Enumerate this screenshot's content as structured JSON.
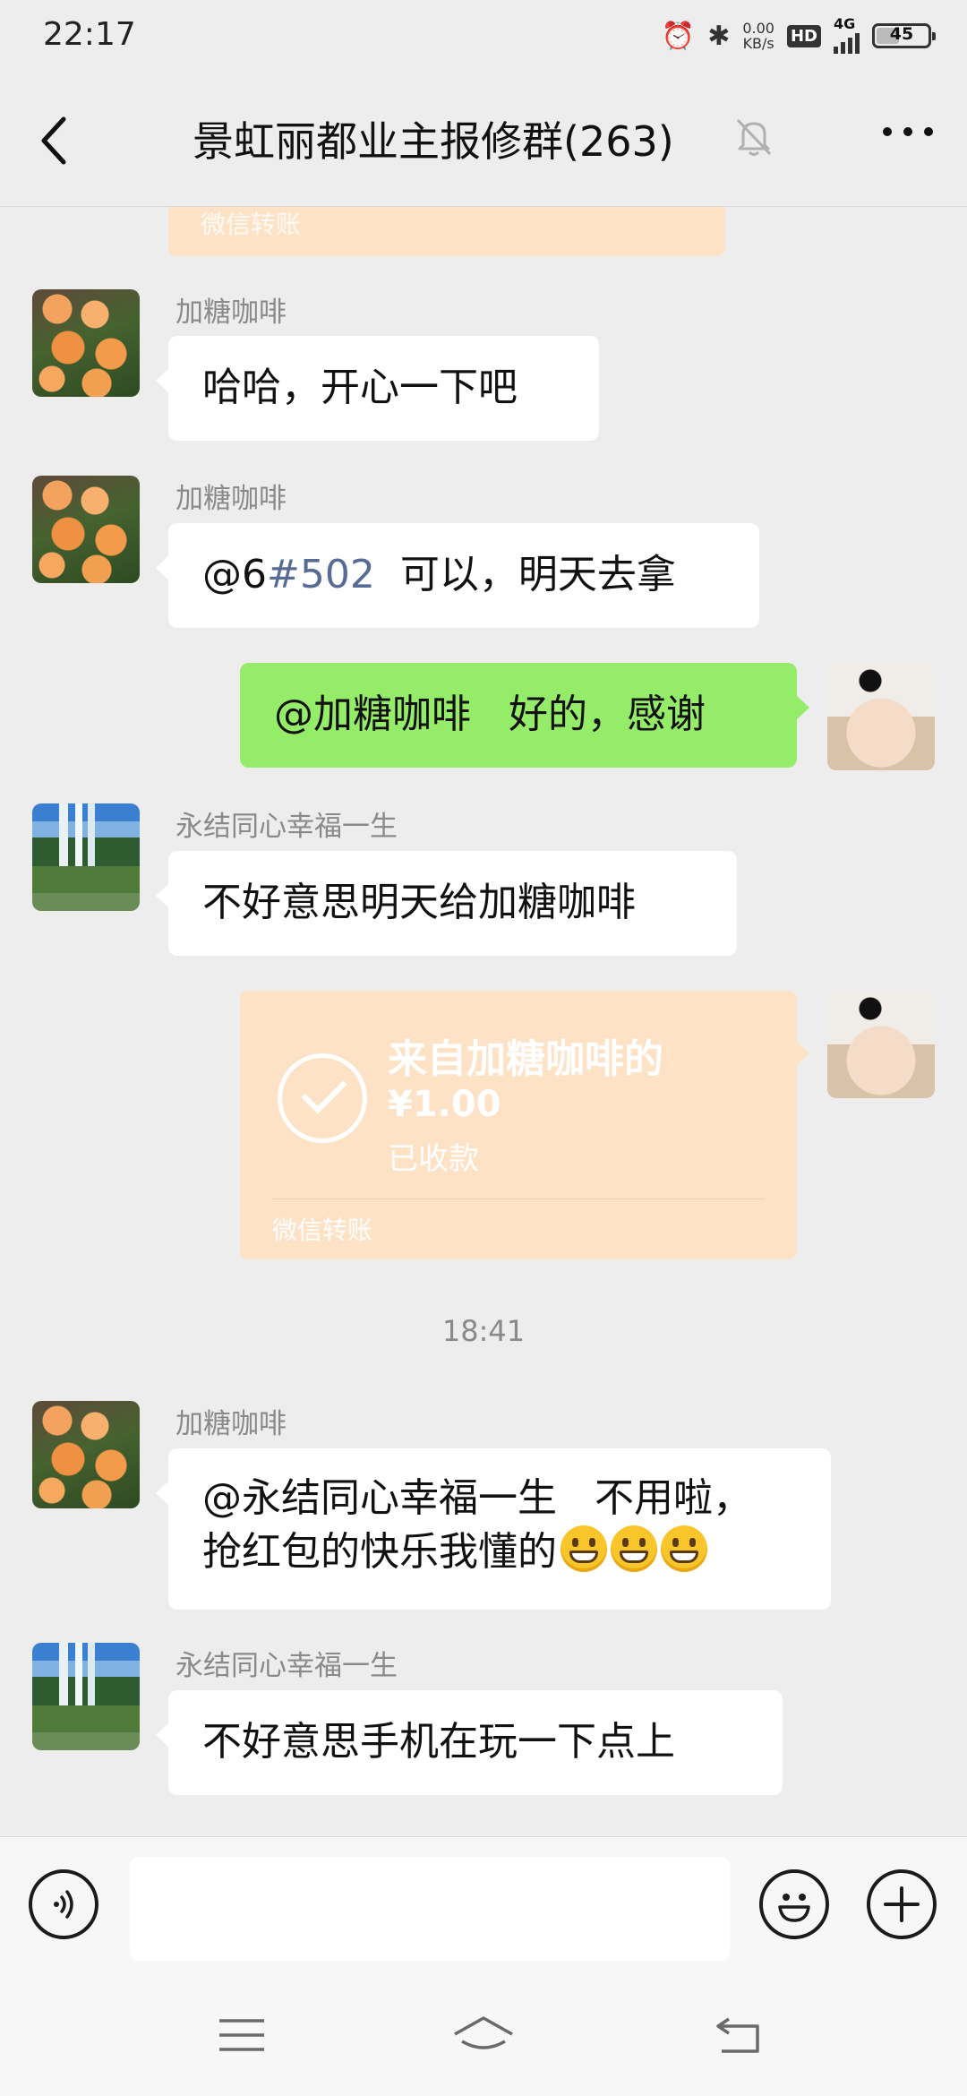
{
  "status_bar": {
    "time": "22:17",
    "alarm_icon": "alarm-icon",
    "bluetooth_icon": "bluetooth-icon",
    "speed_value": "0.00",
    "speed_unit": "KB/s",
    "hd_label": "HD",
    "network_label": "4G",
    "battery_level": "45"
  },
  "header": {
    "back_icon": "chevron-left-icon",
    "title": "景虹丽都业主报修群(263)",
    "mute_icon": "bell-muted-icon",
    "more_icon": "more-icon"
  },
  "chat": {
    "top_partial_transfer_label": "微信转账",
    "messages": [
      {
        "type": "text",
        "side": "left",
        "sender": "加糖咖啡",
        "text": "哈哈，开心一下吧"
      },
      {
        "type": "text",
        "side": "left",
        "sender": "加糖咖啡",
        "text_prefix": "@6",
        "text_mention": "#502",
        "text_suffix": "  可以，明天去拿"
      },
      {
        "type": "text",
        "side": "right",
        "text": "@加糖咖啡   好的，感谢"
      },
      {
        "type": "text",
        "side": "left",
        "sender": "永结同心幸福一生",
        "text": "不好意思明天给加糖咖啡"
      },
      {
        "type": "transfer",
        "side": "right",
        "from": "来自加糖咖啡的",
        "amount": "¥1.00",
        "status": "已收款",
        "footer": "微信转账"
      },
      {
        "type": "time",
        "text": "18:41"
      },
      {
        "type": "text",
        "side": "left",
        "sender": "加糖咖啡",
        "line1": "@永结同心幸福一生   不用啦，",
        "line2": "抢红包的快乐我懂的",
        "emoji": "grinning-face-icon"
      },
      {
        "type": "text",
        "side": "left",
        "sender": "永结同心幸福一生",
        "text": "不好意思手机在玩一下点上"
      }
    ]
  },
  "input_bar": {
    "voice_icon": "voice-icon",
    "input_value": "",
    "emoji_icon": "smiley-icon",
    "plus_icon": "plus-icon"
  },
  "nav_bar": {
    "menu_icon": "menu-icon",
    "home_icon": "home-icon",
    "back_icon": "back-arrow-icon"
  }
}
